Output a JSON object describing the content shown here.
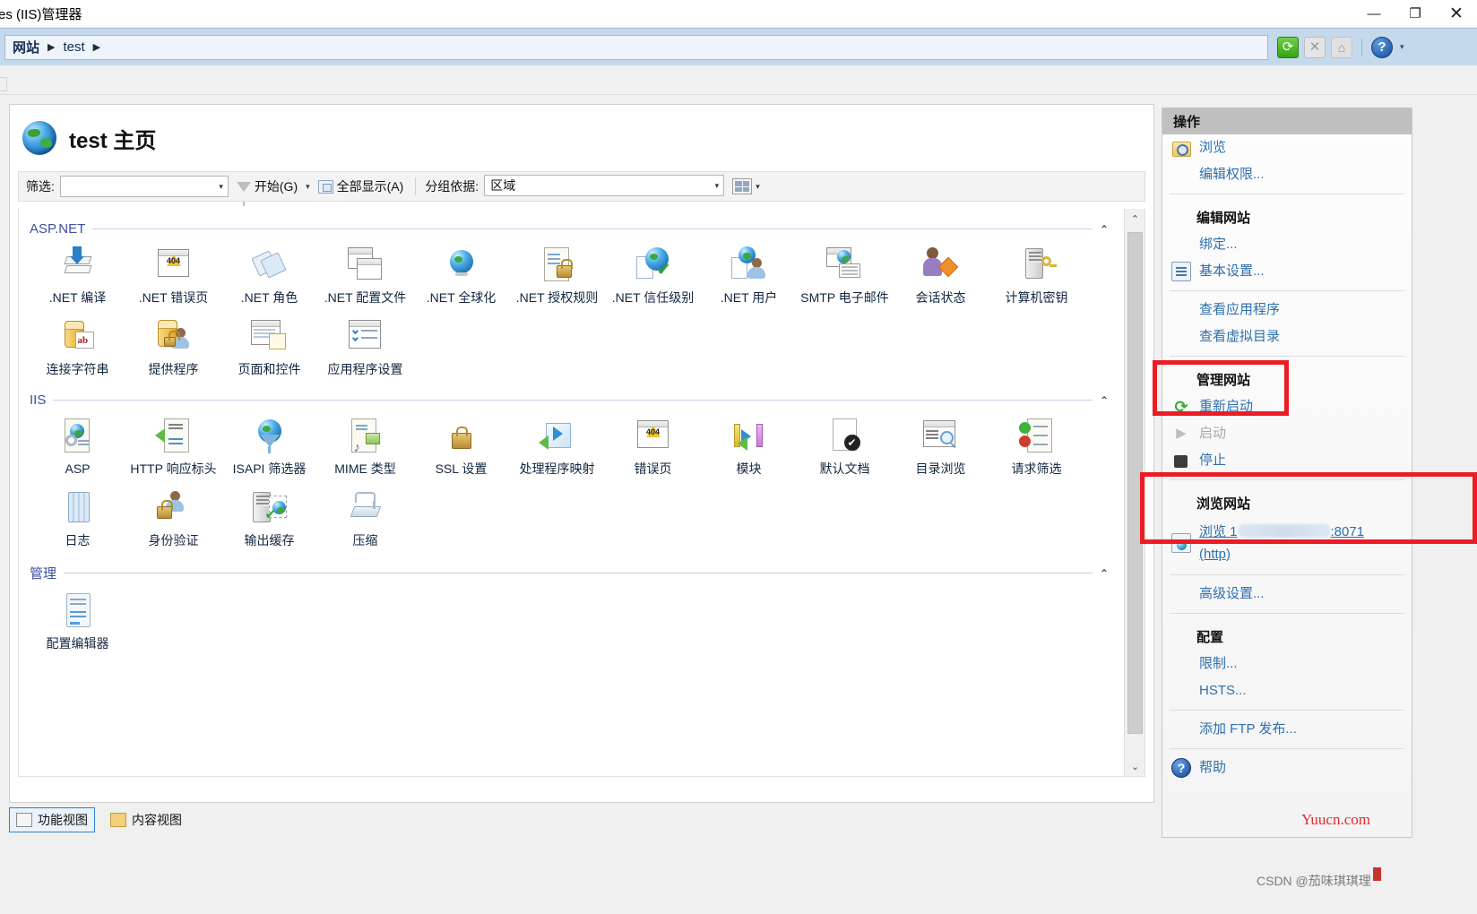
{
  "window": {
    "title": "es (IIS)管理器",
    "minimize": "—",
    "maximize": "❐",
    "close": "✕"
  },
  "breadcrumb": {
    "root": "网站",
    "separator": "▶",
    "site": "test",
    "trailing_separator": "▶"
  },
  "toolbar": {
    "refresh_icon": "refresh-icon",
    "stop_icon": "stop-icon",
    "home_icon": "home-icon",
    "help_icon": "help-icon",
    "dropdown_caret": "▾"
  },
  "page": {
    "title": "test 主页",
    "icon": "site-globe-icon"
  },
  "filter": {
    "label": "筛选:",
    "value": "",
    "placeholder": "",
    "go_label": "开始(G)",
    "show_all_label": "全部显示(A)",
    "group_by_label": "分组依据:",
    "group_by_value": "区域",
    "caret": "▾",
    "view_mode_caret": "▾"
  },
  "groups": [
    {
      "name": "ASP.NET",
      "collapse_chevron": "⌃",
      "items": [
        {
          "label": ".NET 编译",
          "icon": "net-compilation-icon"
        },
        {
          "label": ".NET 错误页",
          "icon": "net-error-pages-icon"
        },
        {
          "label": ".NET 角色",
          "icon": "net-roles-icon"
        },
        {
          "label": ".NET 配置文件",
          "icon": "net-profile-icon"
        },
        {
          "label": ".NET 全球化",
          "icon": "net-globalization-icon"
        },
        {
          "label": ".NET 授权规则",
          "icon": "net-authorization-rules-icon"
        },
        {
          "label": ".NET 信任级别",
          "icon": "net-trust-levels-icon"
        },
        {
          "label": ".NET 用户",
          "icon": "net-users-icon"
        },
        {
          "label": "SMTP 电子邮件",
          "icon": "smtp-email-icon"
        },
        {
          "label": "会话状态",
          "icon": "session-state-icon"
        },
        {
          "label": "计算机密钥",
          "icon": "machine-key-icon"
        },
        {
          "label": "连接字符串",
          "icon": "connection-strings-icon"
        },
        {
          "label": "提供程序",
          "icon": "providers-icon"
        },
        {
          "label": "页面和控件",
          "icon": "pages-and-controls-icon"
        },
        {
          "label": "应用程序设置",
          "icon": "application-settings-icon"
        }
      ]
    },
    {
      "name": "IIS",
      "collapse_chevron": "⌃",
      "items": [
        {
          "label": "ASP",
          "icon": "asp-icon"
        },
        {
          "label": "HTTP 响应标头",
          "icon": "http-response-headers-icon"
        },
        {
          "label": "ISAPI 筛选器",
          "icon": "isapi-filters-icon"
        },
        {
          "label": "MIME 类型",
          "icon": "mime-types-icon"
        },
        {
          "label": "SSL 设置",
          "icon": "ssl-settings-icon"
        },
        {
          "label": "处理程序映射",
          "icon": "handler-mappings-icon"
        },
        {
          "label": "错误页",
          "icon": "error-pages-icon"
        },
        {
          "label": "模块",
          "icon": "modules-icon"
        },
        {
          "label": "默认文档",
          "icon": "default-document-icon"
        },
        {
          "label": "目录浏览",
          "icon": "directory-browsing-icon"
        },
        {
          "label": "请求筛选",
          "icon": "request-filtering-icon"
        },
        {
          "label": "日志",
          "icon": "logging-icon"
        },
        {
          "label": "身份验证",
          "icon": "authentication-icon"
        },
        {
          "label": "输出缓存",
          "icon": "output-caching-icon"
        },
        {
          "label": "压缩",
          "icon": "compression-icon"
        }
      ]
    },
    {
      "name": "管理",
      "collapse_chevron": "⌃",
      "items": [
        {
          "label": "配置编辑器",
          "icon": "configuration-editor-icon"
        }
      ]
    }
  ],
  "view_tabs": [
    {
      "label": "功能视图",
      "icon": "features-view-icon",
      "selected": true
    },
    {
      "label": "内容视图",
      "icon": "content-view-icon",
      "selected": false
    }
  ],
  "actions": {
    "header": "操作",
    "sections": [
      {
        "title": null,
        "items": [
          {
            "label": "浏览",
            "icon": "browse-folder-icon",
            "disabled": false
          },
          {
            "label": "编辑权限...",
            "icon": null,
            "disabled": false
          }
        ]
      },
      {
        "title": "编辑网站",
        "items": [
          {
            "label": "绑定...",
            "icon": null,
            "disabled": false
          },
          {
            "label": "基本设置...",
            "icon": "basic-settings-icon",
            "disabled": false
          }
        ]
      },
      {
        "title": null,
        "items": [
          {
            "label": "查看应用程序",
            "icon": null,
            "disabled": false
          },
          {
            "label": "查看虚拟目录",
            "icon": null,
            "disabled": false
          }
        ]
      },
      {
        "title": "管理网站",
        "items": [
          {
            "label": "重新启动",
            "icon": "restart-icon",
            "disabled": false
          },
          {
            "label": "启动",
            "icon": "start-icon",
            "disabled": true
          },
          {
            "label": "停止",
            "icon": "stop-square-icon",
            "disabled": false
          }
        ]
      },
      {
        "title": "浏览网站",
        "items": [
          {
            "label": "高级设置...",
            "icon": null,
            "disabled": false
          }
        ]
      },
      {
        "title": "配置",
        "items": [
          {
            "label": "限制...",
            "icon": null,
            "disabled": false
          },
          {
            "label": "HSTS...",
            "icon": null,
            "disabled": false
          }
        ]
      },
      {
        "title": null,
        "items": [
          {
            "label": "添加 FTP 发布...",
            "icon": null,
            "disabled": false
          }
        ]
      },
      {
        "title": null,
        "items": [
          {
            "label": "帮助",
            "icon": "help-circle-icon",
            "disabled": false
          }
        ]
      }
    ],
    "browse_link": {
      "prefix": "浏览 1",
      "redacted": true,
      "port": ":8071",
      "protocol": "(http)",
      "icon": "browse-site-icon"
    }
  },
  "annotations": {
    "highlight_color": "#ec1c24",
    "boxes": [
      {
        "name": "restart-highlight",
        "target": "重新启动"
      },
      {
        "name": "browse-site-highlight",
        "target": "浏览 ...:8071 (http)"
      }
    ]
  },
  "watermarks": {
    "site": "Yuucn.com",
    "site_color": "#e8262f",
    "csdn": "CSDN @茄味琪琪理"
  }
}
